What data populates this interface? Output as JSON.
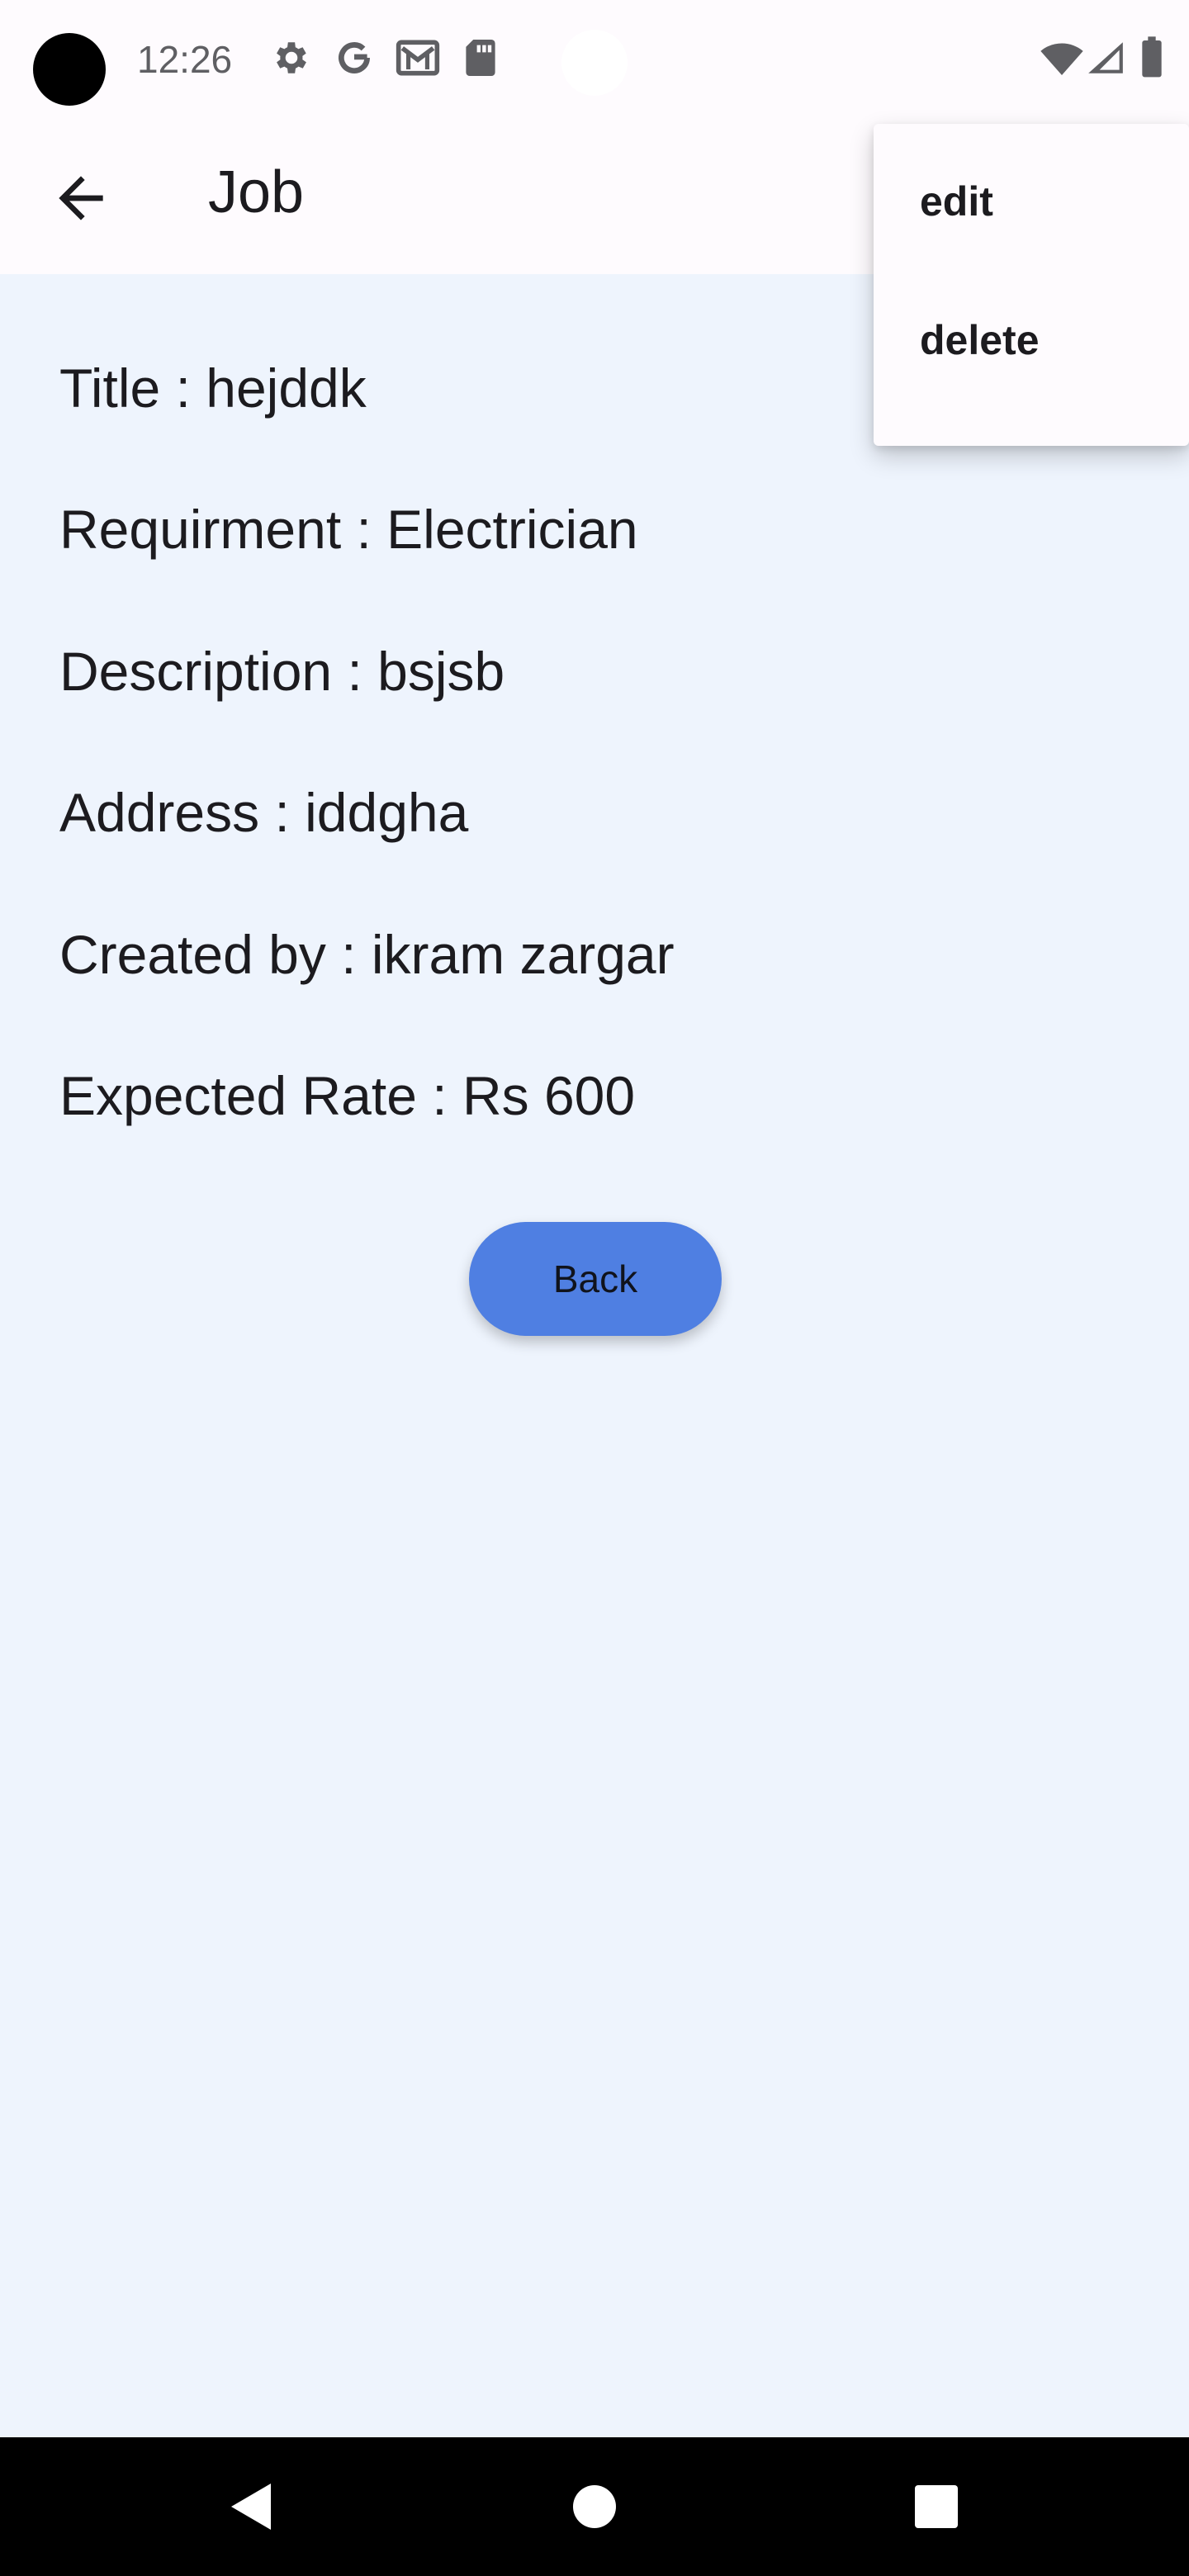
{
  "status_bar": {
    "time": "12:26",
    "icons": [
      "settings-gear-icon",
      "google-g-icon",
      "gmail-icon",
      "sd-card-icon",
      "wifi-icon",
      "signal-icon",
      "battery-icon"
    ]
  },
  "app_bar": {
    "title": "Job",
    "back_icon": "arrow-left-icon"
  },
  "details": [
    {
      "label": "Title",
      "value": "hejddk",
      "text": "Title : hejddk"
    },
    {
      "label": "Requirment",
      "value": "Electrician",
      "text": "Requirment : Electrician"
    },
    {
      "label": "Description",
      "value": "bsjsb",
      "text": "Description : bsjsb"
    },
    {
      "label": "Address",
      "value": "iddgha",
      "text": "Address : iddgha"
    },
    {
      "label": "Created by",
      "value": "ikram zargar",
      "text": "Created by : ikram zargar"
    },
    {
      "label": "Expected Rate",
      "value": "Rs 600",
      "text": "Expected Rate : Rs 600"
    }
  ],
  "back_button": {
    "label": "Back"
  },
  "popup_menu": {
    "items": [
      {
        "label": "edit"
      },
      {
        "label": "delete"
      }
    ]
  },
  "nav_bar": {
    "icons": [
      "back-triangle-icon",
      "home-circle-icon",
      "recents-square-icon"
    ]
  },
  "colors": {
    "background": "#eef4fd",
    "app_bar": "#fefbfe",
    "button": "#4f7fe2",
    "nav_bar": "#000000"
  }
}
